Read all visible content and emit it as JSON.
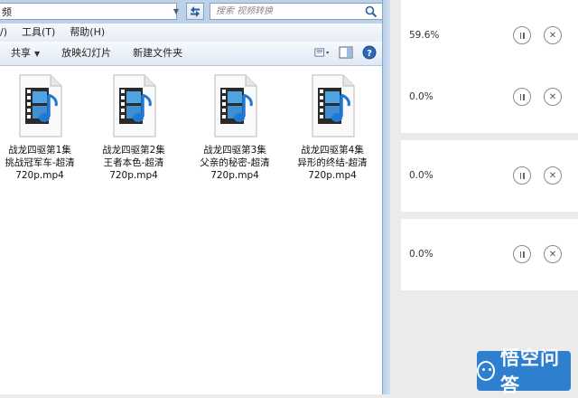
{
  "explorer": {
    "address": "频",
    "search_placeholder": "搜索 视频转换",
    "menu": [
      "/)",
      "工具(T)",
      "帮助(H)"
    ],
    "toolbar": {
      "share": "共享",
      "slideshow": "放映幻灯片",
      "new_folder": "新建文件夹"
    },
    "files": [
      {
        "name_line1": "战龙四驱第1集",
        "name_line2": "挑战冠军车-超清",
        "name_line3": "720p.mp4"
      },
      {
        "name_line1": "战龙四驱第2集",
        "name_line2": "王者本色-超清",
        "name_line3": "720p.mp4"
      },
      {
        "name_line1": "战龙四驱第3集",
        "name_line2": "父亲的秘密-超清",
        "name_line3": "720p.mp4"
      },
      {
        "name_line1": "战龙四驱第4集",
        "name_line2": "异形的终结-超清",
        "name_line3": "720p.mp4"
      }
    ]
  },
  "downloads": [
    {
      "progress": "59.6%"
    },
    {
      "progress": "0.0%"
    },
    {
      "progress": "0.0%"
    },
    {
      "progress": "0.0%"
    }
  ],
  "watermark": {
    "text": "悟空问答"
  },
  "colors": {
    "accent": "#2f7fcf",
    "window_frame": "#bcd2ea"
  }
}
